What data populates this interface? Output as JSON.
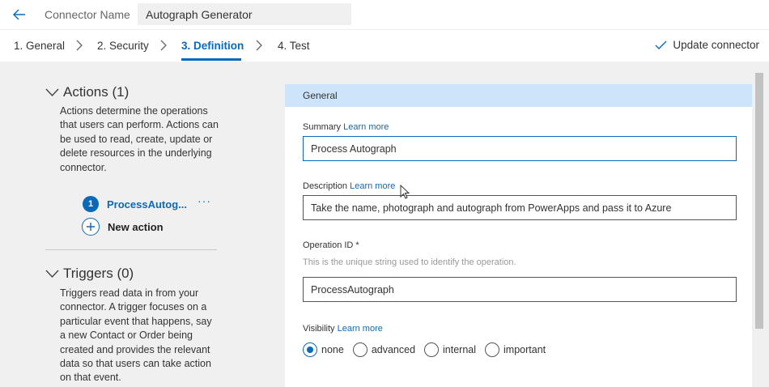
{
  "header": {
    "connector_label": "Connector Name",
    "connector_value": "Autograph Generator"
  },
  "steps": [
    {
      "label": "1. General"
    },
    {
      "label": "2. Security"
    },
    {
      "label": "3. Definition"
    },
    {
      "label": "4. Test"
    }
  ],
  "active_step": "3. Definition",
  "update_label": "Update connector",
  "actions": {
    "title": "Actions (1)",
    "description": "Actions determine the operations that users can perform. Actions can be used to read, create, update or delete resources in the underlying connector.",
    "items": [
      {
        "number": "1",
        "name": "ProcessAutog...",
        "more": "···"
      }
    ],
    "new_action_label": "New action"
  },
  "triggers": {
    "title": "Triggers (0)",
    "description": "Triggers read data in from your connector. A trigger focuses on a particular event that happens, say a new Contact or Order being created and provides the relevant data so that users can take action on that event."
  },
  "general": {
    "header": "General",
    "summary_label": "Summary",
    "summary_link": "Learn more",
    "summary_value": "Process Autograph",
    "description_label": "Description",
    "description_link": "Learn more",
    "description_value": "Take the name, photograph and autograph from PowerApps and pass it to Azure",
    "operation_label": "Operation ID *",
    "operation_help": "This is the unique string used to identify the operation.",
    "operation_value": "ProcessAutograph",
    "visibility_label": "Visibility",
    "visibility_link": "Learn more",
    "visibility_options": [
      "none",
      "advanced",
      "internal",
      "important"
    ],
    "visibility_selected": "none"
  },
  "colors": {
    "accent": "#0b6ab8",
    "panel_bg": "#f0f0f0",
    "card_header_bg": "#cde4fb"
  },
  "icons": {
    "back": "back-arrow-icon",
    "chevron": "chevron-right-icon",
    "check": "checkmark-icon",
    "expand": "chevron-down-icon",
    "add": "plus-circle-icon"
  }
}
